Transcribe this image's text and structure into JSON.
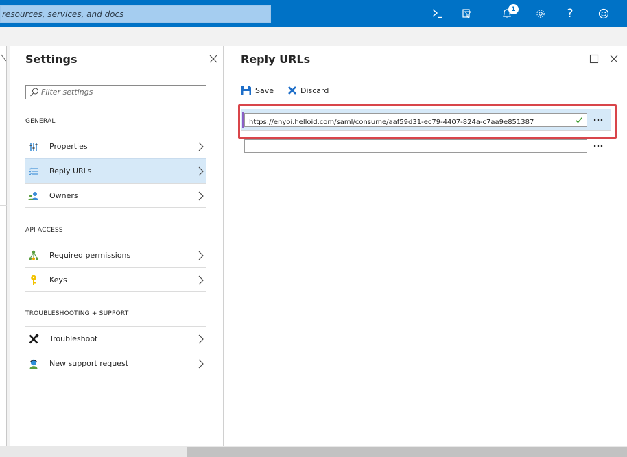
{
  "topbar": {
    "search_placeholder": "resources, services, and docs",
    "notification_count": "1",
    "icons": [
      "cloud-shell-icon",
      "directory-filter-icon",
      "notifications-icon",
      "settings-icon",
      "help-icon",
      "feedback-icon"
    ],
    "help_glyph": "?",
    "color": "#0072c6"
  },
  "settings": {
    "title": "Settings",
    "filter_placeholder": "Filter settings",
    "sections": [
      {
        "header": "GENERAL",
        "items": [
          {
            "label": "Properties",
            "icon": "properties-icon"
          },
          {
            "label": "Reply URLs",
            "icon": "reply-urls-icon",
            "selected": true
          },
          {
            "label": "Owners",
            "icon": "owners-icon"
          }
        ]
      },
      {
        "header": "API ACCESS",
        "items": [
          {
            "label": "Required permissions",
            "icon": "permissions-icon"
          },
          {
            "label": "Keys",
            "icon": "key-icon"
          }
        ]
      },
      {
        "header": "TROUBLESHOOTING + SUPPORT",
        "items": [
          {
            "label": "Troubleshoot",
            "icon": "troubleshoot-icon"
          },
          {
            "label": "New support request",
            "icon": "support-request-icon"
          }
        ]
      }
    ]
  },
  "reply_urls": {
    "title": "Reply URLs",
    "toolbar": {
      "save_label": "Save",
      "discard_label": "Discard"
    },
    "urls": [
      {
        "value": "https://enyoi.helloid.com/saml/consume/aaf59d31-ec79-4407-824a-c7aa9e851387",
        "valid": true
      },
      {
        "value": "",
        "valid": false
      }
    ],
    "more_label": "...",
    "highlight_color": "#d9454a"
  }
}
